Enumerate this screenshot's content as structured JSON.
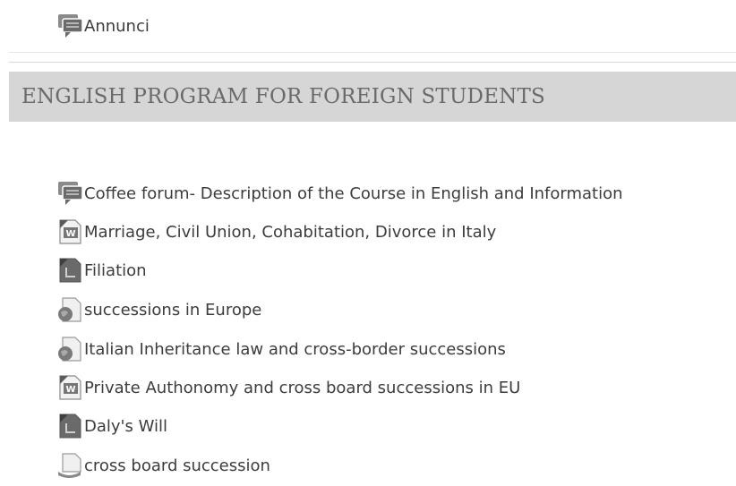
{
  "top": {
    "item": {
      "label": "Annunci",
      "icon": "forum-icon"
    }
  },
  "section": {
    "title": "ENGLISH PROGRAM FOR FOREIGN STUDENTS",
    "items": [
      {
        "label": "Coffee forum- Description of the Course in English and Information",
        "icon": "forum-icon"
      },
      {
        "label": "Marriage, Civil Union, Cohabitation, Divorce in Italy",
        "icon": "word-document-icon"
      },
      {
        "label": "Filiation",
        "icon": "pdf-document-icon"
      },
      {
        "label": "successions in Europe",
        "icon": "url-link-icon"
      },
      {
        "label": "Italian Inheritance law and cross-border successions",
        "icon": "url-link-icon"
      },
      {
        "label": "Private Authonomy and cross board successions in EU",
        "icon": "word-document-icon"
      },
      {
        "label": "Daly's Will",
        "icon": "pdf-document-icon"
      },
      {
        "label": "cross board succession",
        "icon": "file-icon"
      }
    ]
  }
}
